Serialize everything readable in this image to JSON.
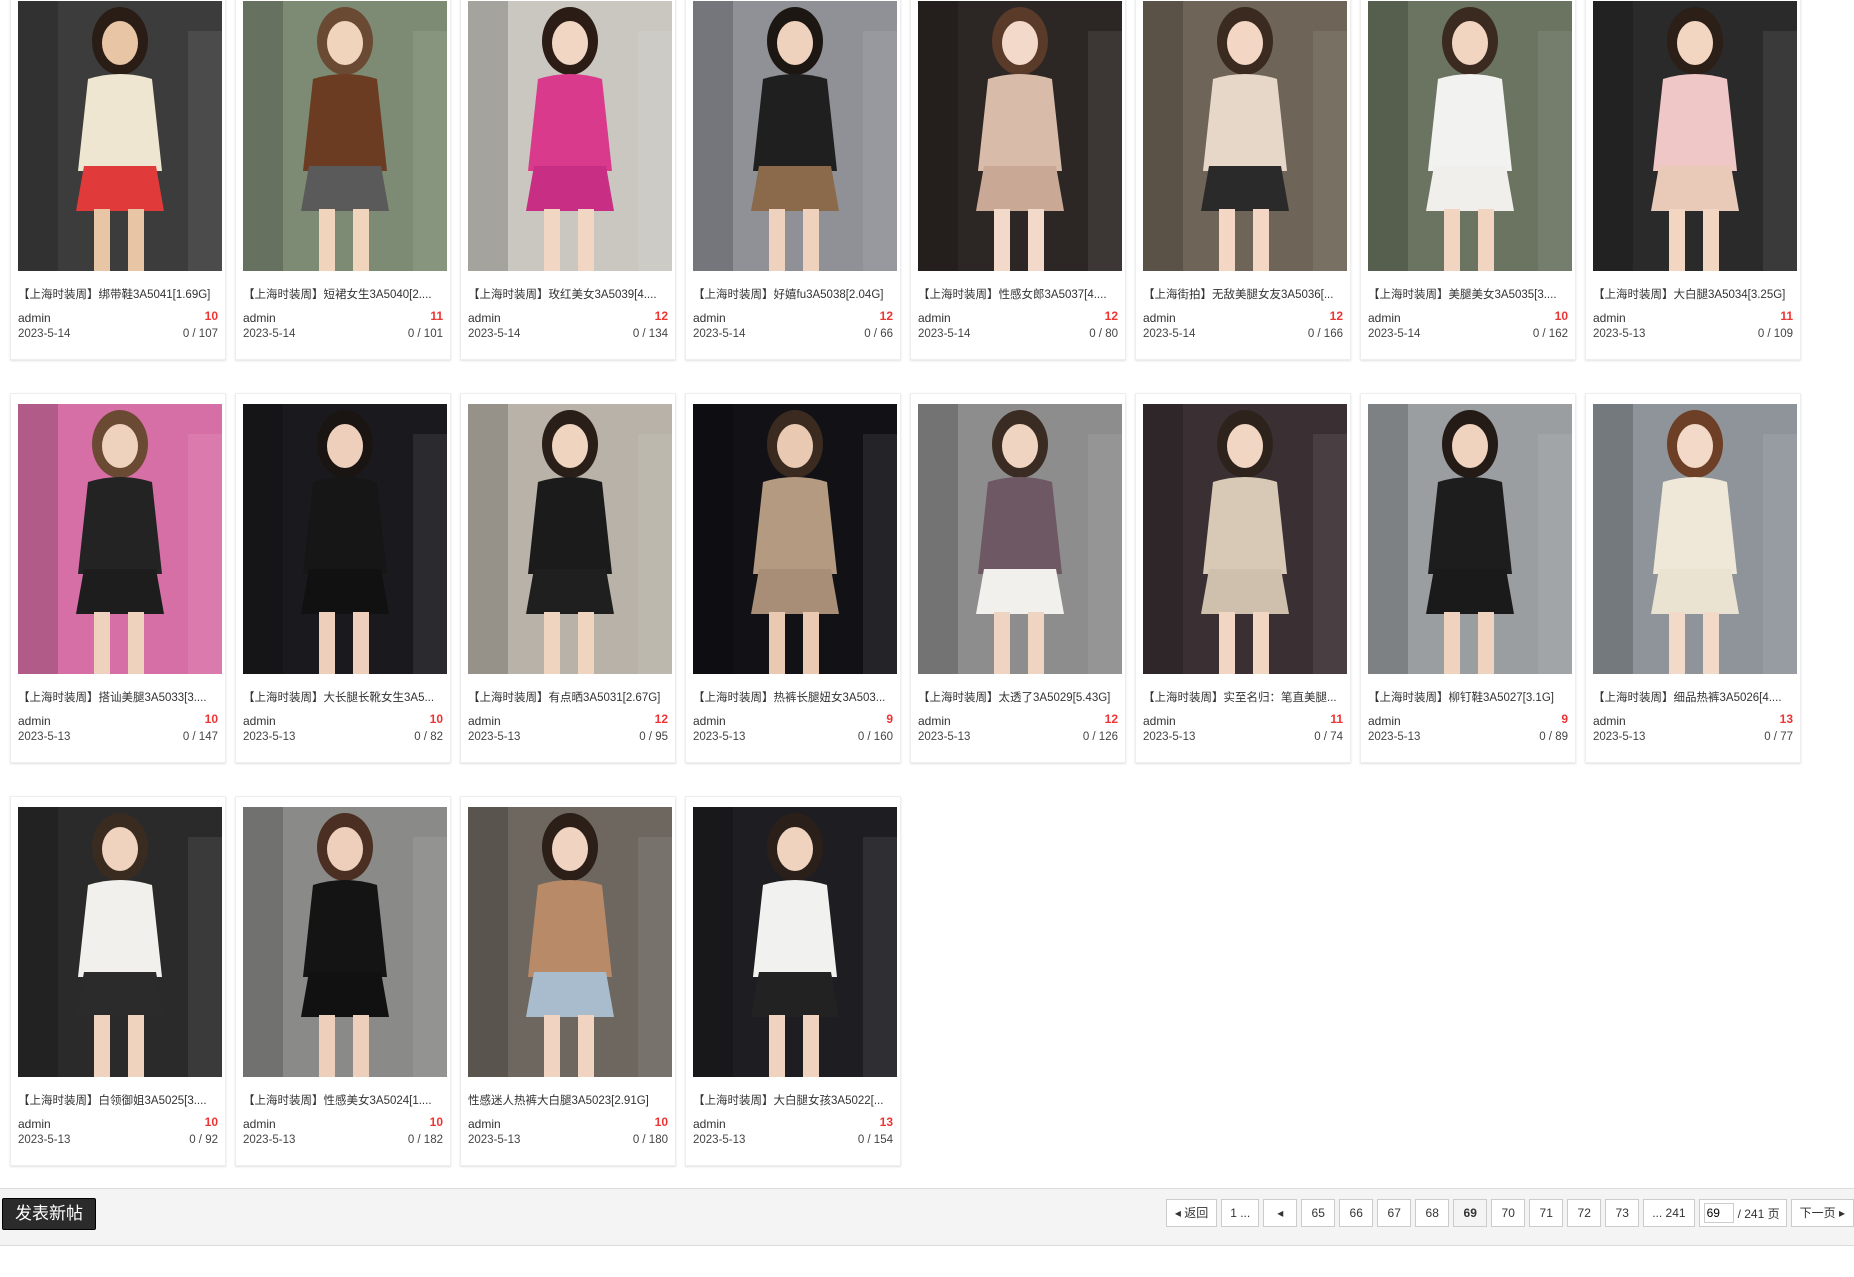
{
  "posts": [
    {
      "title": "【上海时装周】绑带鞋3A5041[1.69G]",
      "author": "admin",
      "count": "10",
      "date": "2023-5-14",
      "stats": "0 / 107",
      "scene": {
        "bg": "#3c3c3c",
        "top": "#efe6d2",
        "bottom": "#e03a3a",
        "skin": "#e8c5a5",
        "hair": "#2a1d16"
      }
    },
    {
      "title": "【上海时装周】短裙女生3A5040[2....",
      "author": "admin",
      "count": "11",
      "date": "2023-5-14",
      "stats": "0 / 101",
      "scene": {
        "bg": "#7d8b74",
        "top": "#6b3b22",
        "bottom": "#5a5a5a",
        "skin": "#f0d4bc",
        "hair": "#6b4a34"
      }
    },
    {
      "title": "【上海时装周】玫红美女3A5039[4....",
      "author": "admin",
      "count": "12",
      "date": "2023-5-14",
      "stats": "0 / 134",
      "scene": {
        "bg": "#c9c7c0",
        "top": "#d93a8c",
        "bottom": "#c82f84",
        "skin": "#f2d6c4",
        "hair": "#2b1d16"
      }
    },
    {
      "title": "【上海时装周】好嬉fu3A5038[2.04G]",
      "author": "admin",
      "count": "12",
      "date": "2023-5-14",
      "stats": "0 / 66",
      "scene": {
        "bg": "#8f9196",
        "top": "#1f1f1f",
        "bottom": "#8a6a4a",
        "skin": "#efd2bd",
        "hair": "#1d1713"
      }
    },
    {
      "title": "【上海时装周】性感女郎3A5037[4....",
      "author": "admin",
      "count": "12",
      "date": "2023-5-14",
      "stats": "0 / 80",
      "scene": {
        "bg": "#2c2624",
        "top": "#d8bba8",
        "bottom": "#caa896",
        "skin": "#f3d9c9",
        "hair": "#5a3a29"
      }
    },
    {
      "title": "【上海街拍】无敌美腿女友3A5036[...",
      "author": "admin",
      "count": "12",
      "date": "2023-5-14",
      "stats": "0 / 166",
      "scene": {
        "bg": "#6e6457",
        "top": "#e6d7c8",
        "bottom": "#2a2a2a",
        "skin": "#f3d7c4",
        "hair": "#3a2a20"
      }
    },
    {
      "title": "【上海时装周】美腿美女3A5035[3....",
      "author": "admin",
      "count": "10",
      "date": "2023-5-14",
      "stats": "0 / 162",
      "scene": {
        "bg": "#6a7460",
        "top": "#f2f2f0",
        "bottom": "#f0efec",
        "skin": "#f1d5c0",
        "hair": "#3b2a1f"
      }
    },
    {
      "title": "【上海时装周】大白腿3A5034[3.25G]",
      "author": "admin",
      "count": "11",
      "date": "2023-5-13",
      "stats": "0 / 109",
      "scene": {
        "bg": "#2a2a2a",
        "top": "#f0c7c7",
        "bottom": "#e9c9b8",
        "skin": "#f2d6c2",
        "hair": "#2b1f18"
      }
    },
    {
      "title": "【上海时装周】搭讪美腿3A5033[3....",
      "author": "admin",
      "count": "10",
      "date": "2023-5-13",
      "stats": "0 / 147",
      "scene": {
        "bg": "#d76fa7",
        "top": "#232323",
        "bottom": "#1d1d1d",
        "skin": "#efd2be",
        "hair": "#6b4a33"
      }
    },
    {
      "title": "【上海时装周】大长腿长靴女生3A5...",
      "author": "admin",
      "count": "10",
      "date": "2023-5-13",
      "stats": "0 / 82",
      "scene": {
        "bg": "#1a1a1e",
        "top": "#161616",
        "bottom": "#111",
        "skin": "#eecfbb",
        "hair": "#1a1412"
      }
    },
    {
      "title": "【上海时装周】有点晒3A5031[2.67G]",
      "author": "admin",
      "count": "12",
      "date": "2023-5-13",
      "stats": "0 / 95",
      "scene": {
        "bg": "#b8b2a8",
        "top": "#1b1b1b",
        "bottom": "#1f1f1f",
        "skin": "#efd4c0",
        "hair": "#2a1f18"
      }
    },
    {
      "title": "【上海时装周】热裤长腿妞女3A503...",
      "author": "admin",
      "count": "9",
      "date": "2023-5-13",
      "stats": "0 / 160",
      "scene": {
        "bg": "#121216",
        "top": "#b59a82",
        "bottom": "#a98e77",
        "skin": "#e9c9b2",
        "hair": "#3a2a20"
      }
    },
    {
      "title": "【上海时装周】太透了3A5029[5.43G]",
      "author": "admin",
      "count": "12",
      "date": "2023-5-13",
      "stats": "0 / 126",
      "scene": {
        "bg": "#8d8d8d",
        "top": "#6e5864",
        "bottom": "#f2f0ec",
        "skin": "#efd4c1",
        "hair": "#3a2c22"
      }
    },
    {
      "title": "【上海时装周】实至名归：笔直美腿...",
      "author": "admin",
      "count": "11",
      "date": "2023-5-13",
      "stats": "0 / 74",
      "scene": {
        "bg": "#3a2f33",
        "top": "#d8c8b6",
        "bottom": "#cfc0ae",
        "skin": "#f1d6c3",
        "hair": "#2e231c"
      }
    },
    {
      "title": "【上海时装周】柳钉鞋3A5027[3.1G]",
      "author": "admin",
      "count": "9",
      "date": "2023-5-13",
      "stats": "0 / 89",
      "scene": {
        "bg": "#9a9ea0",
        "top": "#1d1d1d",
        "bottom": "#1a1a1a",
        "skin": "#efd3bf",
        "hair": "#241b16"
      }
    },
    {
      "title": "【上海时装周】细品热裤3A5026[4....",
      "author": "admin",
      "count": "13",
      "date": "2023-5-13",
      "stats": "0 / 77",
      "scene": {
        "bg": "#8e9499",
        "top": "#efe8d8",
        "bottom": "#ebe3d2",
        "skin": "#f3d9c7",
        "hair": "#6d3f26"
      }
    },
    {
      "title": "【上海时装周】白领御姐3A5025[3....",
      "author": "admin",
      "count": "10",
      "date": "2023-5-13",
      "stats": "0 / 92",
      "scene": {
        "bg": "#2a2a2a",
        "top": "#f1f0ec",
        "bottom": "#2b2b2b",
        "skin": "#efd3bf",
        "hair": "#3a2b21"
      }
    },
    {
      "title": "【上海时装周】性感美女3A5024[1....",
      "author": "admin",
      "count": "10",
      "date": "2023-5-13",
      "stats": "0 / 182",
      "scene": {
        "bg": "#8a8a88",
        "top": "#141414",
        "bottom": "#111",
        "skin": "#eecfbb",
        "hair": "#4a2f22"
      }
    },
    {
      "title": "性感迷人热裤大白腿3A5023[2.91G]",
      "author": "admin",
      "count": "10",
      "date": "2023-5-13",
      "stats": "0 / 180",
      "scene": {
        "bg": "#6d6760",
        "top": "#b98a68",
        "bottom": "#a9bccd",
        "skin": "#f0d4c1",
        "hair": "#2b1f18"
      }
    },
    {
      "title": "【上海时装周】大白腿女孩3A5022[...",
      "author": "admin",
      "count": "13",
      "date": "2023-5-13",
      "stats": "0 / 154",
      "scene": {
        "bg": "#1e1e22",
        "top": "#f1f1ef",
        "bottom": "#222",
        "skin": "#efd3bf",
        "hair": "#2a1f19"
      }
    }
  ],
  "toolbar": {
    "new_post_label": "发表新帖"
  },
  "pagination": {
    "back_label": "返回",
    "first_label": "1 ...",
    "pages": [
      "65",
      "66",
      "67",
      "68",
      "69",
      "70",
      "71",
      "72",
      "73"
    ],
    "current": "69",
    "last_label": "... 241",
    "input_value": "69",
    "total_label": "/ 241 页",
    "next_label": "下一页"
  },
  "icons": {
    "prev": "triangle-left-icon",
    "next": "triangle-right-icon"
  }
}
